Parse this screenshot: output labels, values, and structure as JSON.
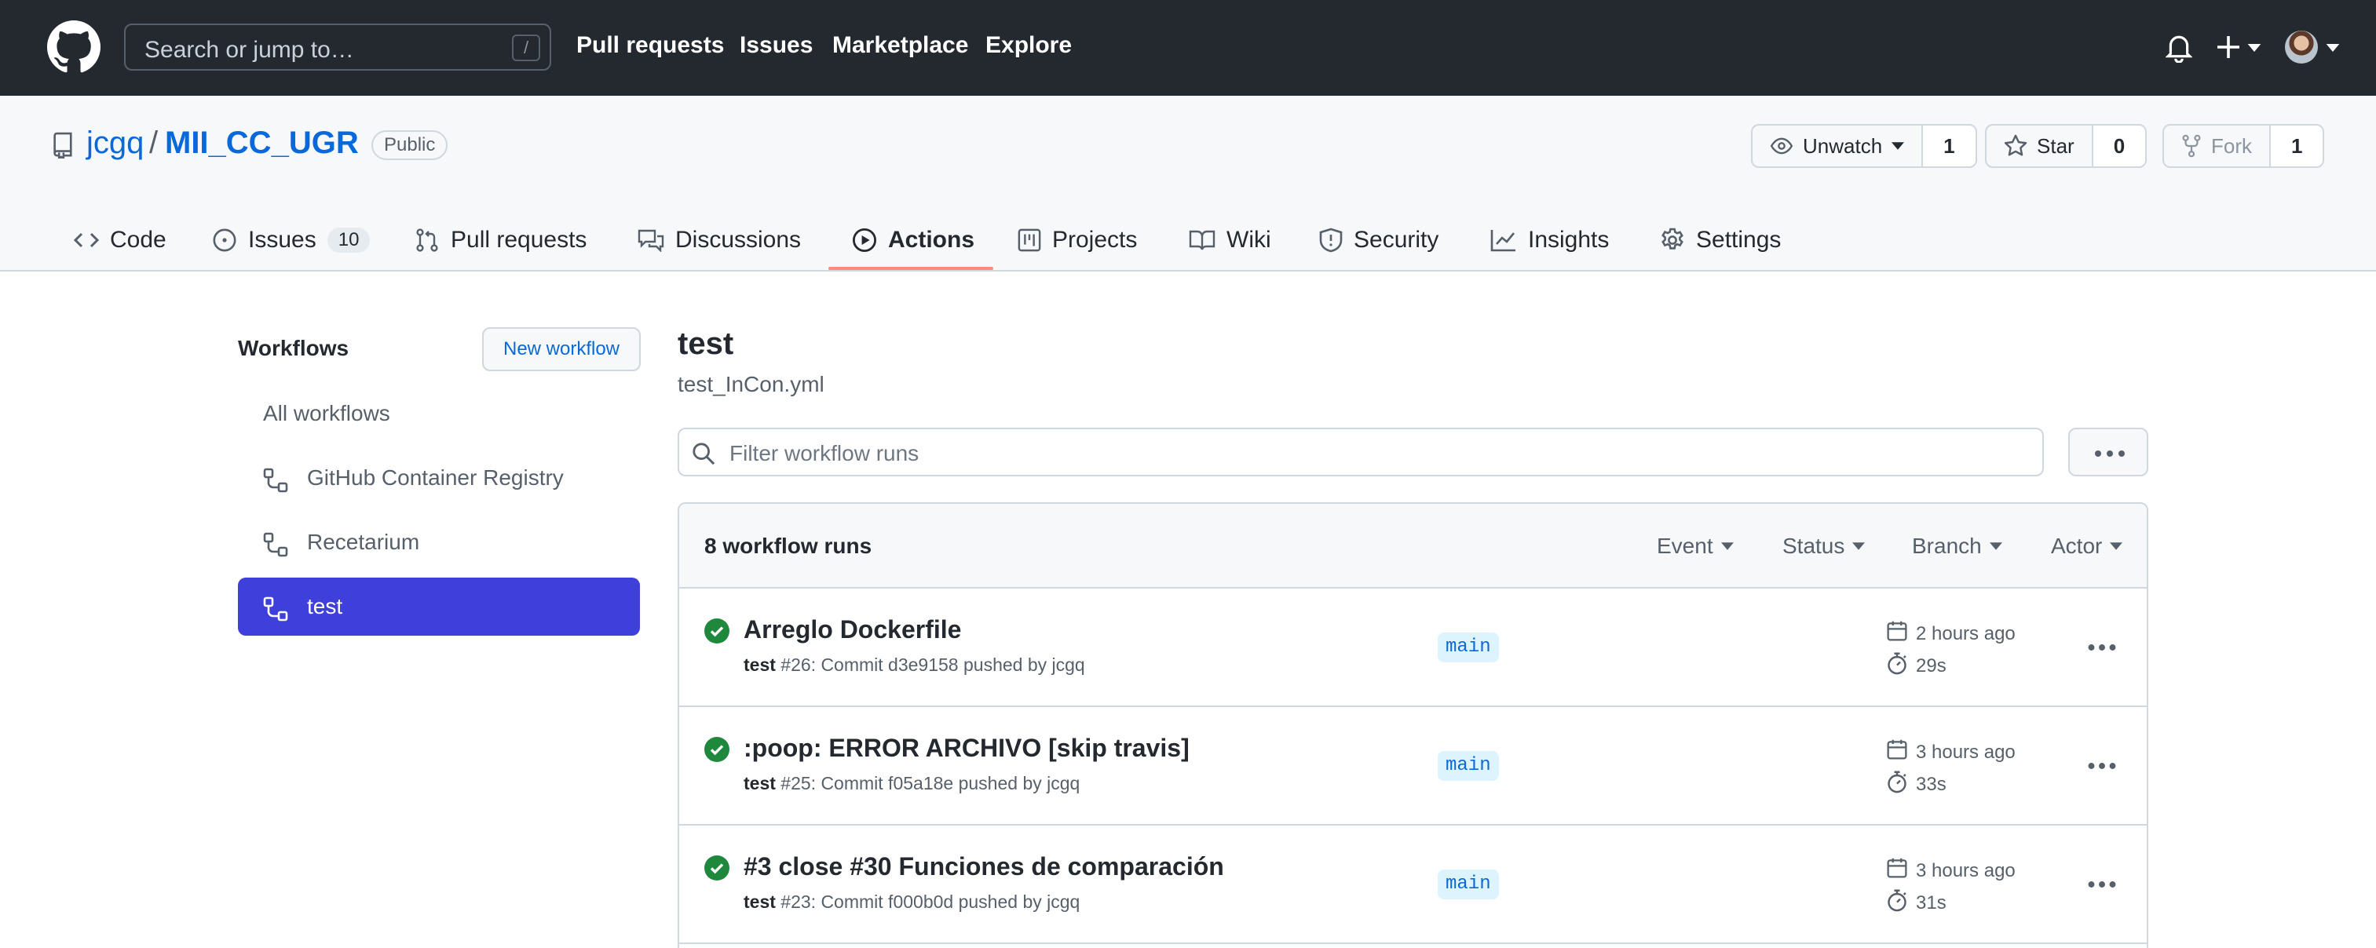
{
  "header": {
    "search_placeholder": "Search or jump to…",
    "search_shortcut": "/",
    "nav": [
      "Pull requests",
      "Issues",
      "Marketplace",
      "Explore"
    ]
  },
  "repo": {
    "owner": "jcgq",
    "separator": "/",
    "name": "MII_CC_UGR",
    "visibility": "Public",
    "watch": {
      "label": "Unwatch",
      "count": "1"
    },
    "star": {
      "label": "Star",
      "count": "0"
    },
    "fork": {
      "label": "Fork",
      "count": "1"
    },
    "tabs": {
      "code": "Code",
      "issues": "Issues",
      "issues_count": "10",
      "pulls": "Pull requests",
      "discussions": "Discussions",
      "actions": "Actions",
      "projects": "Projects",
      "wiki": "Wiki",
      "security": "Security",
      "insights": "Insights",
      "settings": "Settings"
    }
  },
  "sidebar": {
    "title": "Workflows",
    "new_button": "New workflow",
    "all": "All workflows",
    "items": [
      "GitHub Container Registry",
      "Recetarium",
      "test"
    ]
  },
  "main": {
    "workflow_name": "test",
    "workflow_file": "test_InCon.yml",
    "filter_placeholder": "Filter workflow runs",
    "runs_count": "8 workflow runs",
    "filters": [
      "Event",
      "Status",
      "Branch",
      "Actor"
    ],
    "runs": [
      {
        "title": "Arreglo Dockerfile",
        "workflow": "test",
        "detail": " #26: Commit d3e9158 pushed by jcgq",
        "branch": "main",
        "when": "2 hours ago",
        "duration": "29s"
      },
      {
        "title": ":poop: ERROR ARCHIVO [skip travis]",
        "workflow": "test",
        "detail": " #25: Commit f05a18e pushed by jcgq",
        "branch": "main",
        "when": "3 hours ago",
        "duration": "33s"
      },
      {
        "title": "#3 close #30 Funciones de comparación",
        "workflow": "test",
        "detail": " #23: Commit f000b0d pushed by jcgq",
        "branch": "main",
        "when": "3 hours ago",
        "duration": "31s"
      }
    ]
  },
  "colors": {
    "header_bg": "#24292f",
    "accent_blue": "#0969da",
    "selected_item": "#3f3fdb",
    "success_green": "#1f883d",
    "active_tab_underline": "#fd8c73"
  },
  "icons": [
    "github-logo-icon",
    "bell-icon",
    "plus-icon",
    "repo-icon",
    "eye-icon",
    "star-icon",
    "fork-icon",
    "code-icon",
    "issue-icon",
    "pull-request-icon",
    "discussion-icon",
    "play-icon",
    "project-icon",
    "book-icon",
    "shield-icon",
    "graph-icon",
    "gear-icon",
    "workflow-icon",
    "search-icon",
    "kebab-icon",
    "check-circle-icon",
    "calendar-icon",
    "stopwatch-icon"
  ]
}
